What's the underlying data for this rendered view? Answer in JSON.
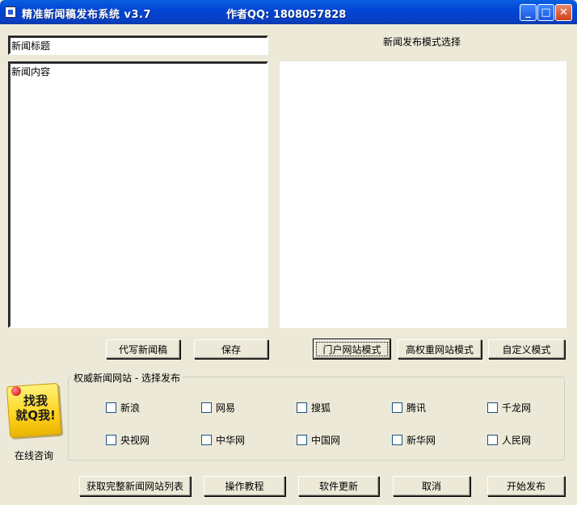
{
  "window": {
    "title": "精准新闻稿发布系统 v3.7",
    "author": "作者QQ: 1808057828"
  },
  "editor": {
    "title_value": "新闻标题",
    "content_value": "新闻内容"
  },
  "mode_panel": {
    "label": "新闻发布模式选择"
  },
  "buttons": {
    "ghostwrite": "代写新闻稿",
    "save": "保存",
    "portal_mode": "门户网站模式",
    "high_weight_mode": "高权重网站模式",
    "custom_mode": "自定义模式",
    "get_list": "获取完整新闻网站列表",
    "tutorial": "操作教程",
    "update": "软件更新",
    "cancel": "取消",
    "publish": "开始发布"
  },
  "sites_group": {
    "label": "权威新闻网站 - 选择发布",
    "sites": [
      "新浪",
      "网易",
      "搜狐",
      "腾讯",
      "千龙网",
      "央视网",
      "中华网",
      "中国网",
      "新华网",
      "人民网"
    ]
  },
  "promo": {
    "text": "找我\n就Q我!",
    "caption": "在线咨询"
  }
}
